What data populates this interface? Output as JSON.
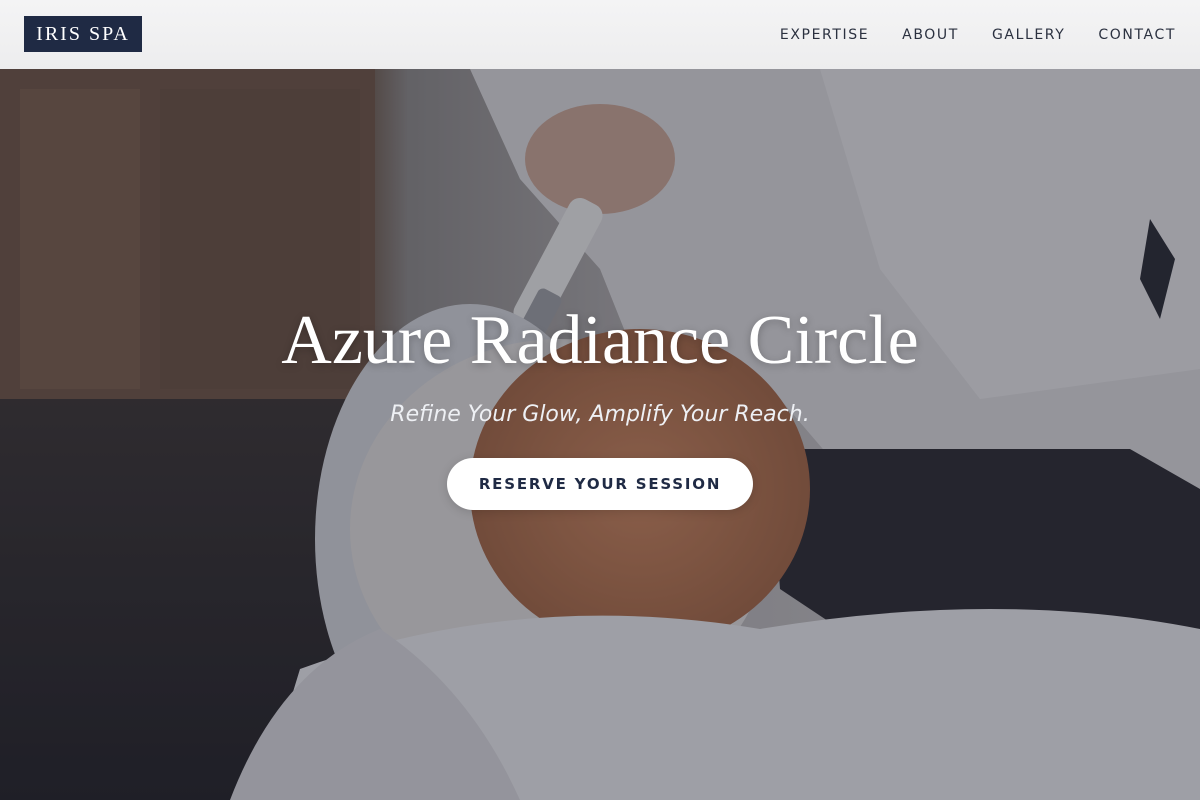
{
  "brand": {
    "logo_text": "IRIS SPA",
    "color": "#1f2a44"
  },
  "nav": {
    "items": [
      {
        "label": "EXPERTISE"
      },
      {
        "label": "ABOUT"
      },
      {
        "label": "GALLERY"
      },
      {
        "label": "CONTACT"
      }
    ]
  },
  "hero": {
    "title": "Azure Radiance Circle",
    "subtitle": "Refine Your Glow, Amplify Your Reach.",
    "cta_label": "RESERVE YOUR SESSION"
  },
  "colors": {
    "header_bg": "#f0f0f1",
    "nav_text": "#2b3140",
    "cta_bg": "#ffffff",
    "cta_text": "#1f2a44"
  }
}
